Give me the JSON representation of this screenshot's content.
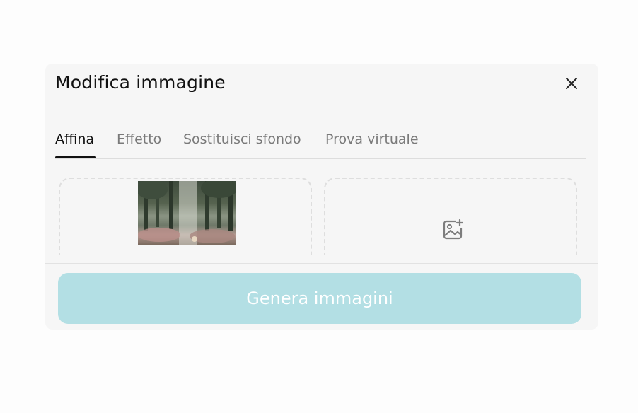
{
  "dialog": {
    "title": "Modifica immagine",
    "close_icon": "close-icon"
  },
  "tabs": [
    {
      "label": "Affina",
      "active": true
    },
    {
      "label": "Effetto",
      "active": false
    },
    {
      "label": "Sostituisci sfondo",
      "active": false
    },
    {
      "label": "Prova virtuale",
      "active": false
    }
  ],
  "upload": {
    "source_image": "forest-scene-thumbnail",
    "reference_icon": "add-image-icon"
  },
  "footer": {
    "generate_label": "Genera immagini",
    "generate_enabled": false
  },
  "colors": {
    "accent_disabled": "#b3dfe4",
    "text_primary": "#111111",
    "text_secondary": "#7a7a7a"
  }
}
